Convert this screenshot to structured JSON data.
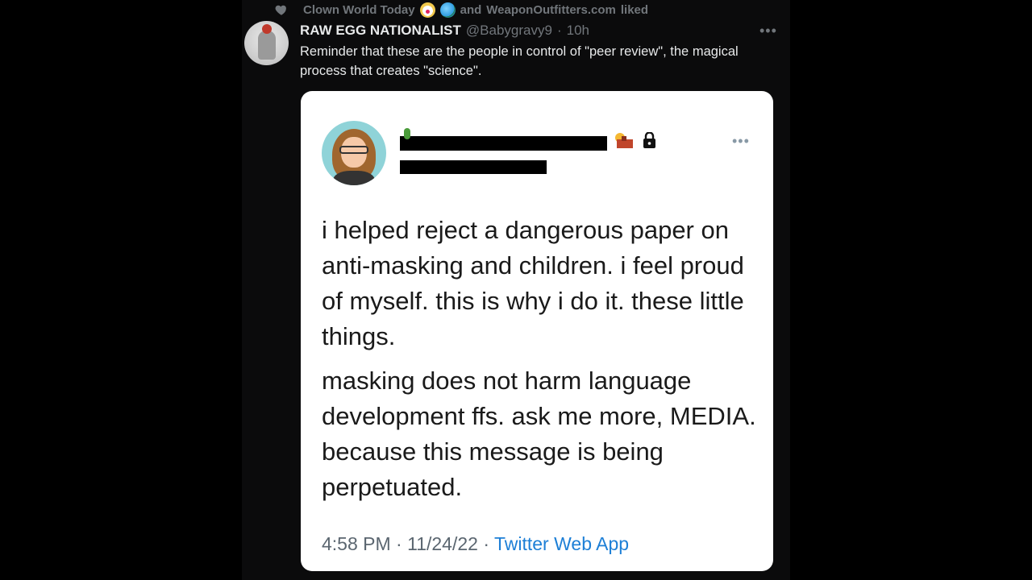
{
  "liked_by": {
    "first": "Clown World Today",
    "connector": "and",
    "second": "WeaponOutfitters.com",
    "suffix": "liked"
  },
  "tweet": {
    "author_name": "RAW EGG NATIONALIST",
    "author_handle": "@Babygravy9",
    "separator": "·",
    "age": "10h",
    "more": "•••",
    "text": "Reminder that these are the people in control of \"peer review\", the magical process that creates \"science\"."
  },
  "quoted": {
    "more": "•••",
    "paragraph_1": "i helped reject a dangerous paper on anti-masking and children. i feel proud of myself. this is why i do it. these little things.",
    "paragraph_2": "masking does not harm language development ffs. ask me more, MEDIA. because this message is being perpetuated.",
    "time": "4:58 PM",
    "sep1": "·",
    "date": "11/24/22",
    "sep2": "·",
    "app": "Twitter Web App"
  },
  "colors": {
    "background": "#000000",
    "column": "#0b0b0c",
    "text_primary": "#e7e9ea",
    "text_secondary": "#71767b",
    "link": "#1d7fd6"
  },
  "icons": [
    "heart-icon",
    "clown-emoji-icon",
    "globe-emoji-icon",
    "more-icon",
    "cactus-icon",
    "desert-icon",
    "lock-icon"
  ]
}
